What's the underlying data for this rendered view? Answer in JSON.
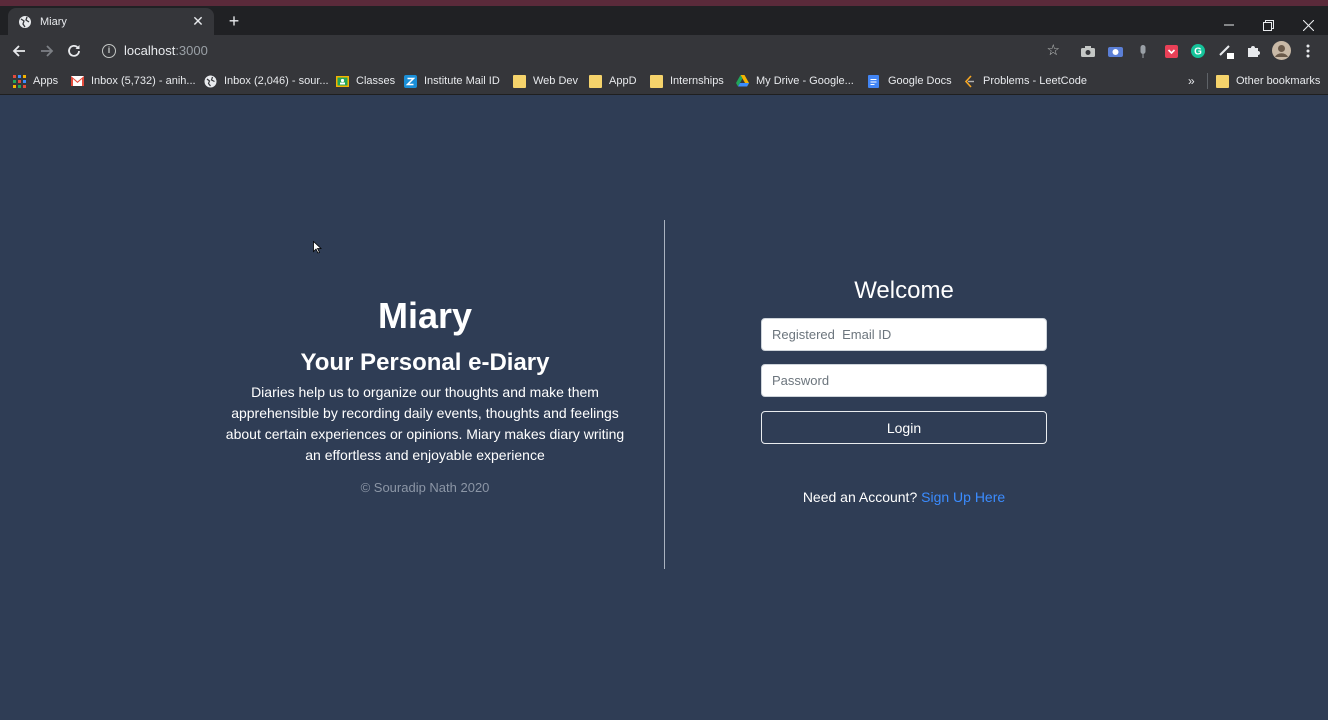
{
  "browser": {
    "tab_title": "Miary",
    "url_host": "localhost",
    "url_port": ":3000",
    "bookmarks": [
      {
        "label": "Apps",
        "icon": "apps-grid-icon"
      },
      {
        "label": "Inbox (5,732) - anih...",
        "icon": "gmail-icon"
      },
      {
        "label": "Inbox (2,046) - sour...",
        "icon": "globe-icon"
      },
      {
        "label": "Classes",
        "icon": "classroom-icon"
      },
      {
        "label": "Institute Mail ID",
        "icon": "zimbra-icon"
      },
      {
        "label": "Web Dev",
        "icon": "folder-icon"
      },
      {
        "label": "AppD",
        "icon": "folder-icon"
      },
      {
        "label": "Internships",
        "icon": "folder-icon"
      },
      {
        "label": "My Drive - Google...",
        "icon": "drive-icon"
      },
      {
        "label": "Google Docs",
        "icon": "docs-icon"
      },
      {
        "label": "Problems - LeetCode",
        "icon": "leetcode-icon"
      }
    ],
    "overflow_label": "»",
    "other_bookmarks": "Other bookmarks"
  },
  "hero": {
    "brand": "Miary",
    "tagline": "Your Personal e-Diary",
    "description": "Diaries help us to organize our thoughts and make them apprehensible by recording daily events, thoughts and feelings about certain experiences or opinions. Miary makes diary writing an effortless and enjoyable experience",
    "copyright": "© Souradip Nath 2020"
  },
  "login": {
    "heading": "Welcome",
    "email_placeholder": "Registered  Email ID",
    "password_placeholder": "Password",
    "button": "Login",
    "signup_prompt": "Need an Account?",
    "signup_link": "Sign Up Here"
  },
  "colors": {
    "page_bg": "#2f3d55",
    "link": "#3b8cff"
  }
}
